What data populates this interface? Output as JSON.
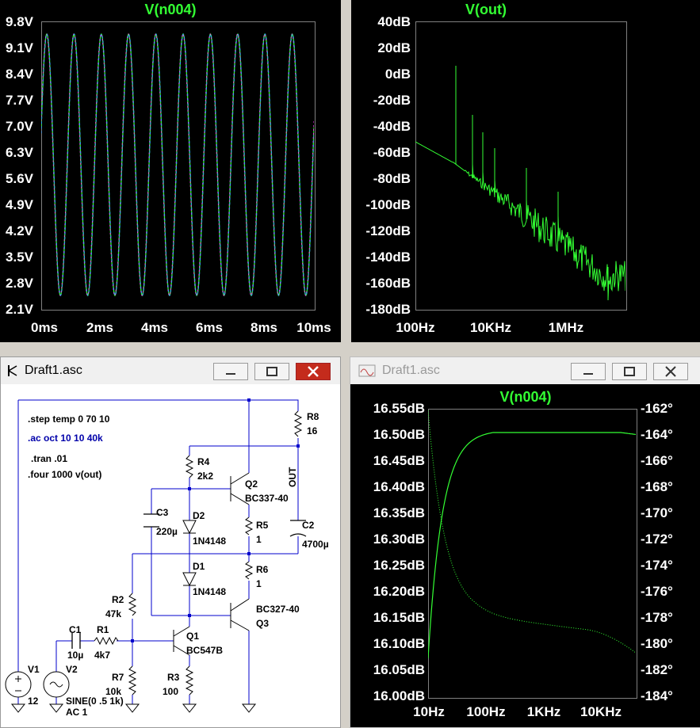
{
  "colors": {
    "trace": "#33ff33",
    "wire": "#0000cc",
    "directive": "#0000aa"
  },
  "plot_tran": {
    "title": "V(n004)",
    "y_ticks": [
      "9.8V",
      "9.1V",
      "8.4V",
      "7.7V",
      "7.0V",
      "6.3V",
      "5.6V",
      "4.9V",
      "4.2V",
      "3.5V",
      "2.8V",
      "2.1V"
    ],
    "x_ticks": [
      "0ms",
      "2ms",
      "4ms",
      "6ms",
      "8ms",
      "10ms"
    ]
  },
  "plot_fft": {
    "title": "V(out)",
    "y_ticks": [
      "40dB",
      "20dB",
      "0dB",
      "-20dB",
      "-40dB",
      "-60dB",
      "-80dB",
      "-100dB",
      "-120dB",
      "-140dB",
      "-160dB",
      "-180dB"
    ],
    "x_ticks": [
      "100Hz",
      "10KHz",
      "1MHz"
    ]
  },
  "schematic_window": {
    "title": "Draft1.asc",
    "directives": {
      "step": ".step temp 0 70 10",
      "ac": ".ac oct 10 10 40k",
      "tran": ".tran .01",
      "four": ".four 1000 v(out)"
    },
    "labels": {
      "r8": "R8",
      "r8v": "16",
      "out": "OUT",
      "r4": "R4",
      "r4v": "2k2",
      "q2": "Q2",
      "q2t": "BC337-40",
      "c3": "C3",
      "c3v": "220µ",
      "d2": "D2",
      "d2t": "1N4148",
      "r5": "R5",
      "r5v": "1",
      "c2": "C2",
      "c2v": "4700µ",
      "d1": "D1",
      "d1t": "1N4148",
      "r6": "R6",
      "r6v": "1",
      "r2": "R2",
      "r2v": "47k",
      "q3t": "BC327-40",
      "q3": "Q3",
      "c1": "C1",
      "c1v": "10µ",
      "r1": "R1",
      "r1v": "4k7",
      "q1": "Q1",
      "q1t": "BC547B",
      "v1": "V1",
      "v1v": "12",
      "v2": "V2",
      "v2v1": "SINE(0 .5 1k)",
      "v2v2": "AC 1",
      "r7": "R7",
      "r7v": "10k",
      "r3": "R3",
      "r3v": "100"
    }
  },
  "ac_window": {
    "title": "Draft1.asc",
    "plot_title": "V(n004)",
    "y_ticks_left": [
      "16.55dB",
      "16.50dB",
      "16.45dB",
      "16.40dB",
      "16.35dB",
      "16.30dB",
      "16.25dB",
      "16.20dB",
      "16.15dB",
      "16.10dB",
      "16.05dB",
      "16.00dB"
    ],
    "y_ticks_right": [
      "-162°",
      "-164°",
      "-166°",
      "-168°",
      "-170°",
      "-172°",
      "-174°",
      "-176°",
      "-178°",
      "-180°",
      "-182°",
      "-184°"
    ],
    "x_ticks": [
      "10Hz",
      "100Hz",
      "1KHz",
      "10KHz"
    ]
  }
}
